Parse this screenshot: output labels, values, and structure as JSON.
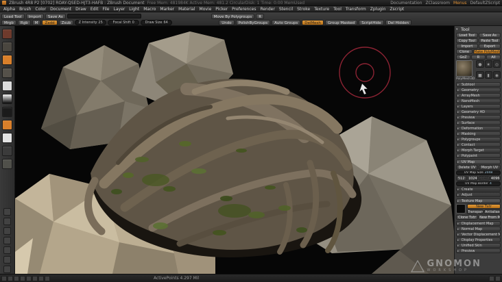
{
  "title_bar": {
    "title": "ZBrush 4R8 P2 [0702] ROAY-QSED-HJT3-HAFB : ZBrush Document",
    "stats": "Free Mem: 481984K  Active Mem: 481.2  CircularDisk: 1  Time: 0:00  MemUsed",
    "right_items": [
      "Documentation",
      "ZClassroom",
      "Menus",
      "DefaultZScript"
    ]
  },
  "menu": {
    "items": [
      "Alpha",
      "Brush",
      "Color",
      "Document",
      "Draw",
      "Edit",
      "File",
      "Layer",
      "Light",
      "Macro",
      "Marker",
      "Material",
      "Movie",
      "Picker",
      "Preferences",
      "Render",
      "Stencil",
      "Stroke",
      "Texture",
      "Tool",
      "Transform",
      "Zplugin",
      "Zscript"
    ]
  },
  "shelf": {
    "row1_left": [
      "Load Tool",
      "Import",
      "Save As"
    ],
    "row1_right": [
      "Move By Polygroups",
      "R"
    ],
    "row2_paint": [
      "Mrgb",
      "Rgb",
      "M"
    ],
    "row2_sculpt": [
      "Zadd",
      "Zsub"
    ],
    "row2_sliders": [
      {
        "label": "Z Intensity",
        "value": "25"
      },
      {
        "label": "Focal Shift",
        "value": "0"
      },
      {
        "label": "Draw Size",
        "value": "64"
      }
    ],
    "row2_right": [
      "Undo",
      "PolishByGroups",
      "Auto Groups",
      "DelMesh",
      "Group Masked",
      "ScriptHide",
      "Del Hidden"
    ]
  },
  "left_tray": {
    "icons": [
      {
        "name": "brush-icon",
        "color": "#6e3a2c"
      },
      {
        "name": "stroke-icon",
        "color": "#4a463f"
      },
      {
        "name": "alpha-icon",
        "color": "#d97f2a"
      },
      {
        "name": "texture-icon",
        "color": "#55514a"
      },
      {
        "name": "material-icon",
        "color": "#dcdcdc"
      },
      {
        "name": "color-gradient-icon",
        "color": "gradient"
      },
      {
        "name": "main-color-swatch",
        "color": "#1b1b1b"
      },
      {
        "name": "secondary-color-swatch",
        "color": "#d97f2a"
      },
      {
        "name": "swatch-white-icon",
        "color": "#e3e3e3"
      },
      {
        "name": "swatch-gray-icon",
        "color": "#3b3b3b"
      },
      {
        "name": "picker-icon",
        "color": "#50504a"
      }
    ],
    "bottom_icons": [
      "scroll-doc-icon",
      "zoom-doc-icon",
      "actual-size-icon",
      "aa-half-icon",
      "grid-icon",
      "persp-icon",
      "frame-icon"
    ]
  },
  "tool_panel": {
    "title": "Tool",
    "file_rows": [
      [
        "Load Tool",
        "Save As"
      ],
      [
        "Copy Tool",
        "Paste Tool"
      ],
      [
        "Import",
        "Export"
      ]
    ],
    "goz_row": [
      "GoZ",
      "R",
      "All"
    ],
    "clone_row": [
      "Clone",
      "Make PolyMesh3D"
    ],
    "active_tool_name": "PolyMesh3D",
    "quick_pick_icons": [
      "sphere3d-icon",
      "star3d-icon",
      "ring3d-icon",
      "cube3d-icon",
      "cylinder3d-icon",
      "zsphere-icon"
    ],
    "sections": [
      "Subtool",
      "Geometry",
      "ArrayMesh",
      "NanoMesh",
      "Layers",
      "Geometry HD",
      "Preview",
      "Surface",
      "Deformation",
      "Masking",
      "Polygroups",
      "Contact",
      "Morph Target",
      "Polypaint"
    ],
    "uv_map": {
      "title": "UV Map",
      "buttons": [
        "Delete UV",
        "Morph UV"
      ],
      "size_slider_label": "UV Map Size",
      "size_slider_value": "2048",
      "presets": [
        "512",
        "1024",
        "2048",
        "4096"
      ],
      "border_slider_label": "UV Map Border",
      "border_slider_value": "4",
      "subsections": [
        "Create",
        "Adjust"
      ]
    },
    "texture_map": {
      "title": "Texture Map",
      "new_button": "New Txtr",
      "toggles": [
        "Transparent",
        "Antialiased"
      ],
      "buttons": [
        "Clone Txtr",
        "New From Polypaint"
      ]
    },
    "bottom_sections": [
      "Displacement Map",
      "Normal Map",
      "Vector Displacement Map",
      "Display Properties",
      "Unified Skin",
      "Preview"
    ]
  },
  "canvas": {
    "watermark_line1": "GNOMON",
    "watermark_line2": "WORKSHOP"
  },
  "bottom_bar": {
    "status": "ActivePoints 4.297 Mil",
    "left_icon_names": [
      "doc-nav-icon",
      "brush-mini-icon",
      "alpha-mini-icon",
      "texture-mini-icon",
      "material-mini-icon",
      "stroke-mini-icon",
      "color-mini-icon",
      "layer-mini-icon"
    ],
    "right_icon_names": [
      "zoom-out-icon",
      "zoom-in-icon"
    ]
  }
}
